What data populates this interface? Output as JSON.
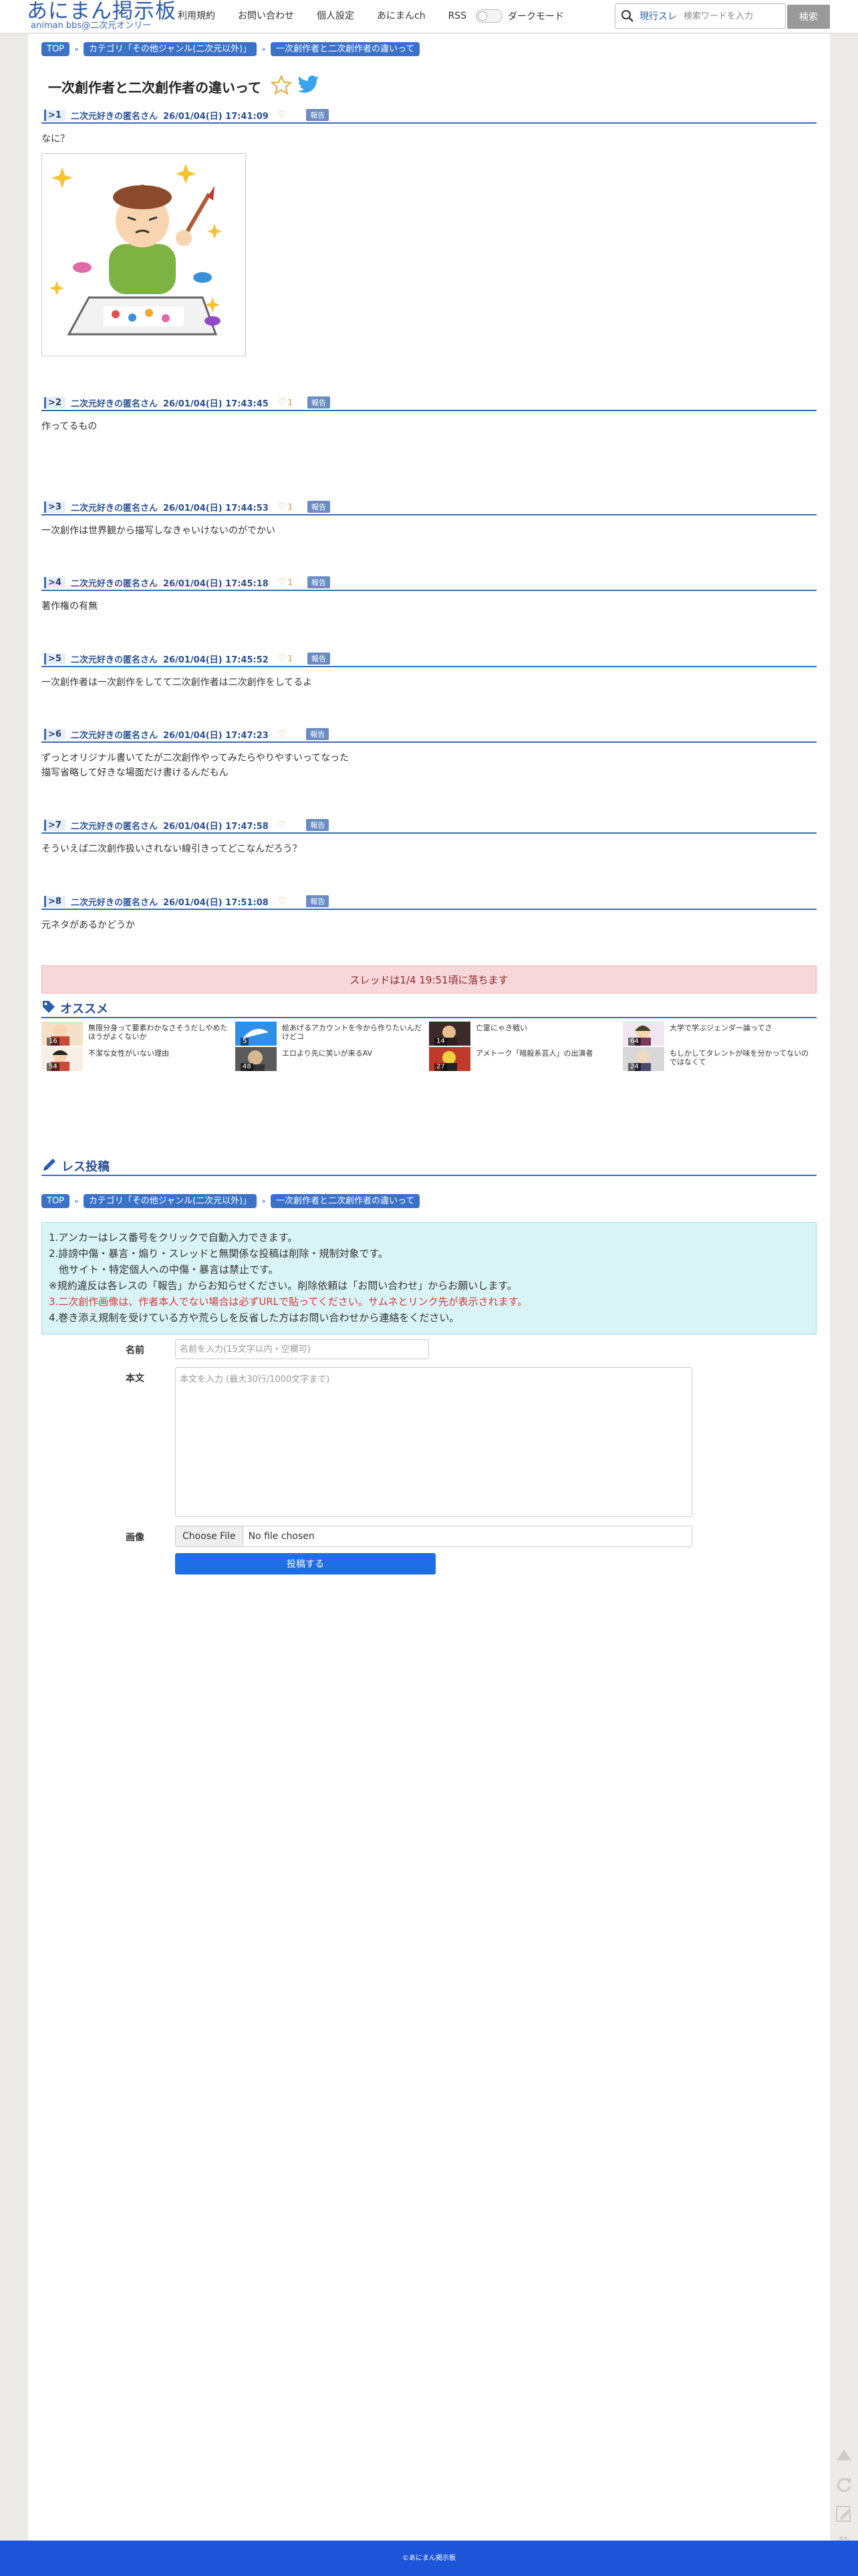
{
  "site": {
    "logo_title": "あにまん掲示板",
    "logo_sub": "animan bbs@二次元オンリー",
    "nav": [
      "利用規約",
      "お問い合わせ",
      "個人設定",
      "あにまんch",
      "RSS"
    ],
    "dark_mode_label": "ダークモード",
    "search_scope": "現行スレ",
    "search_placeholder": "検索ワードを入力",
    "search_button": "検索"
  },
  "breadcrumb": [
    "TOP",
    "カテゴリ「その他ジャンル(二次元以外)」",
    "一次創作者と二次創作者の違いって"
  ],
  "thread": {
    "title": "一次創作者と二次創作者の違いって"
  },
  "posts": [
    {
      "num": ">1",
      "name": "二次元好きの匿名さん",
      "date": "26/01/04(日) 17:41:09",
      "likes": "",
      "report": "報告",
      "lines": [
        "なに？"
      ]
    },
    {
      "num": ">2",
      "name": "二次元好きの匿名さん",
      "date": "26/01/04(日) 17:43:45",
      "likes": "1",
      "report": "報告",
      "lines": [
        "作ってるもの"
      ]
    },
    {
      "num": ">3",
      "name": "二次元好きの匿名さん",
      "date": "26/01/04(日) 17:44:53",
      "likes": "1",
      "report": "報告",
      "lines": [
        "一次創作は世界観から描写しなきゃいけないのがでかい"
      ]
    },
    {
      "num": ">4",
      "name": "二次元好きの匿名さん",
      "date": "26/01/04(日) 17:45:18",
      "likes": "1",
      "report": "報告",
      "lines": [
        "著作権の有無"
      ]
    },
    {
      "num": ">5",
      "name": "二次元好きの匿名さん",
      "date": "26/01/04(日) 17:45:52",
      "likes": "1",
      "report": "報告",
      "lines": [
        "一次創作者は一次創作をしてて二次創作者は二次創作をしてるよ"
      ]
    },
    {
      "num": ">6",
      "name": "二次元好きの匿名さん",
      "date": "26/01/04(日) 17:47:23",
      "likes": "",
      "report": "報告",
      "lines": [
        "ずっとオリジナル書いてたが二次創作やってみたらやりやすいってなった",
        "描写省略して好きな場面だけ書けるんだもん"
      ]
    },
    {
      "num": ">7",
      "name": "二次元好きの匿名さん",
      "date": "26/01/04(日) 17:47:58",
      "likes": "",
      "report": "報告",
      "lines": [
        "そういえば二次創作扱いされない線引きってどこなんだろう？"
      ]
    },
    {
      "num": ">8",
      "name": "二次元好きの匿名さん",
      "date": "26/01/04(日) 17:51:08",
      "likes": "",
      "report": "報告",
      "lines": [
        "元ネタがあるかどうか"
      ]
    }
  ],
  "expire_notice": "スレッドは1/4 19:51頃に落ちます",
  "recommend": {
    "title": "オススメ",
    "items": [
      {
        "title": "無限分身って要素わかなさそうだしやめたほうがよくないか",
        "count": "16"
      },
      {
        "title": "絵あげるアカウントを今から作りたいんだけどコ",
        "count": "5"
      },
      {
        "title": "亡霊にゃき戦い",
        "count": "14"
      },
      {
        "title": "大学で学ぶジェンダー論ってさ",
        "count": "64"
      },
      {
        "title": "不潔な女性がいない理由",
        "count": "54"
      },
      {
        "title": "エロより先に笑いが来るAV",
        "count": "48"
      },
      {
        "title": "アメトーク「暗殺系芸人」の出演者",
        "count": "27"
      },
      {
        "title": "もしかしてタレントが味を分かってないのではなくて",
        "count": "24"
      }
    ]
  },
  "reply": {
    "title": "レス投稿",
    "notice": [
      "1.アンカーはレス番号をクリックで自動入力できます。",
      "2.誹謗中傷・暴言・煽り・スレッドと無関係な投稿は削除・規制対象です。",
      "　他サイト・特定個人への中傷・暴言は禁止です。",
      "※規約違反は各レスの「報告」からお知らせください。削除依頼は「お問い合わせ」からお願いします。",
      "3.二次創作画像は、作者本人でない場合は必ずURLで貼ってください。サムネとリンク先が表示されます。",
      "4.巻き添え規制を受けている方や荒らしを反省した方はお問い合わせから連絡をください。"
    ],
    "name_label": "名前",
    "name_placeholder": "名前を入力(15文字以内・空欄可)",
    "body_label": "本文",
    "body_placeholder": "本文を入力 (最大30行/1000文字まで)",
    "image_label": "画像",
    "file_button": "Choose File",
    "file_status": "No file chosen",
    "submit": "投稿する"
  },
  "footer": "©あにまん掲示板",
  "colors": {
    "brand_blue": "#3b71c7",
    "footer_blue": "#1e55d8",
    "submit_blue": "#1e6ee6",
    "expire_bg": "#f8d7da",
    "notice_bg": "#d9f4f7"
  }
}
